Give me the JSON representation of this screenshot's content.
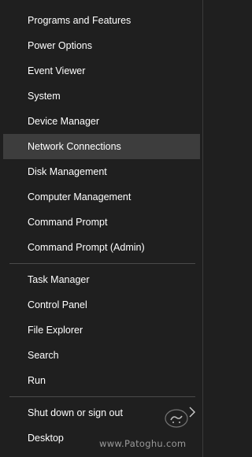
{
  "menu": {
    "group1": [
      {
        "label": "Programs and Features"
      },
      {
        "label": "Power Options"
      },
      {
        "label": "Event Viewer"
      },
      {
        "label": "System"
      },
      {
        "label": "Device Manager"
      },
      {
        "label": "Network Connections",
        "highlighted": true
      },
      {
        "label": "Disk Management"
      },
      {
        "label": "Computer Management"
      },
      {
        "label": "Command Prompt"
      },
      {
        "label": "Command Prompt (Admin)"
      }
    ],
    "group2": [
      {
        "label": "Task Manager"
      },
      {
        "label": "Control Panel"
      },
      {
        "label": "File Explorer"
      },
      {
        "label": "Search"
      },
      {
        "label": "Run"
      }
    ],
    "group3": [
      {
        "label": "Shut down or sign out",
        "has_submenu": true
      },
      {
        "label": "Desktop"
      }
    ]
  },
  "watermark": {
    "logo_text": "پاتوق",
    "site": "www.Patoghu.com"
  },
  "colors": {
    "background": "#1f1f1f",
    "highlight": "#3d3d3d",
    "text": "#ffffff",
    "separator": "#4a4a4a"
  }
}
